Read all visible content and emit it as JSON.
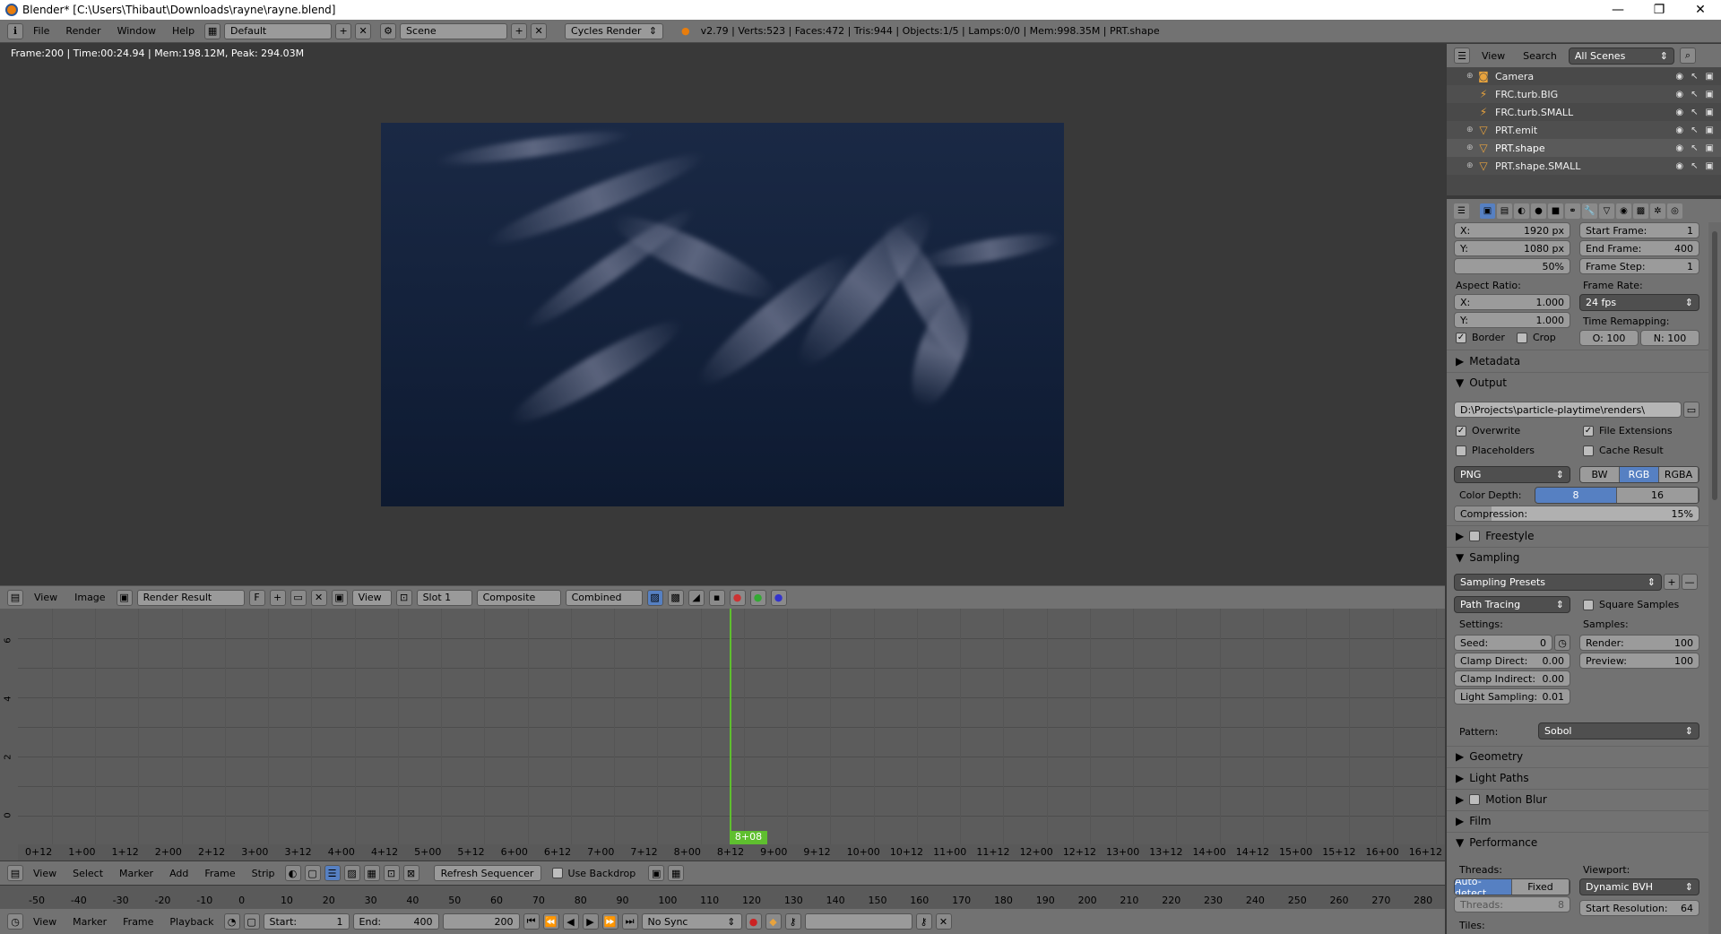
{
  "window": {
    "title": "Blender* [C:\\Users\\Thibaut\\Downloads\\rayne\\rayne.blend]"
  },
  "info_header": {
    "menus": [
      "File",
      "Render",
      "Window",
      "Help"
    ],
    "screen": "Default",
    "scene": "Scene",
    "engine": "Cycles Render",
    "stats": "v2.79 | Verts:523 | Faces:472 | Tris:944 | Objects:1/5 | Lamps:0/0 | Mem:998.35M | PRT.shape"
  },
  "image_editor": {
    "status": "Frame:200 | Time:00:24.94 | Mem:198.12M, Peak: 294.03M",
    "menus": [
      "View",
      "Image"
    ],
    "image_name": "Render Result",
    "fake_user": "F",
    "view_menu": "View",
    "slot": "Slot 1",
    "layer": "Composite",
    "pass": "Combined"
  },
  "graph": {
    "playhead_label": "8+08",
    "y_labels": [
      "6",
      "4",
      "2",
      "0"
    ],
    "x_ticks": [
      "0+12",
      "1+00",
      "1+12",
      "2+00",
      "2+12",
      "3+00",
      "3+12",
      "4+00",
      "4+12",
      "5+00",
      "5+12",
      "6+00",
      "6+12",
      "7+00",
      "7+12",
      "8+00",
      "8+12",
      "9+00",
      "9+12",
      "10+00",
      "10+12",
      "11+00",
      "11+12",
      "12+00",
      "12+12",
      "13+00",
      "13+12",
      "14+00",
      "14+12",
      "15+00",
      "15+12",
      "16+00",
      "16+12"
    ]
  },
  "sequencer_header": {
    "menus": [
      "View",
      "Select",
      "Marker",
      "Add",
      "Frame",
      "Strip"
    ],
    "refresh": "Refresh Sequencer",
    "use_backdrop": "Use Backdrop"
  },
  "timeline": {
    "ticks": [
      "-50",
      "-40",
      "-30",
      "-20",
      "-10",
      "0",
      "10",
      "20",
      "30",
      "40",
      "50",
      "60",
      "70",
      "80",
      "90",
      "100",
      "110",
      "120",
      "130",
      "140",
      "150",
      "160",
      "170",
      "180",
      "190",
      "200",
      "210",
      "220",
      "230",
      "240",
      "250",
      "260",
      "270",
      "280"
    ]
  },
  "timeline_header": {
    "menus": [
      "View",
      "Marker",
      "Frame",
      "Playback"
    ],
    "start_label": "Start:",
    "start": "1",
    "end_label": "End:",
    "end": "400",
    "current": "200",
    "sync": "No Sync"
  },
  "outliner": {
    "menus": [
      "View",
      "Search"
    ],
    "filter": "All Scenes",
    "items": [
      {
        "name": "Camera",
        "icon": "camera-icon"
      },
      {
        "name": "FRC.turb.BIG",
        "icon": "force-field-icon"
      },
      {
        "name": "FRC.turb.SMALL",
        "icon": "force-field-icon"
      },
      {
        "name": "PRT.emit",
        "icon": "mesh-icon"
      },
      {
        "name": "PRT.shape",
        "icon": "mesh-icon"
      },
      {
        "name": "PRT.shape.SMALL",
        "icon": "mesh-icon"
      }
    ]
  },
  "properties": {
    "resolution_x": {
      "label": "X:",
      "value": "1920 px"
    },
    "resolution_y": {
      "label": "Y:",
      "value": "1080 px"
    },
    "resolution_pct": "50%",
    "start_frame": {
      "label": "Start Frame:",
      "value": "1"
    },
    "end_frame": {
      "label": "End Frame:",
      "value": "400"
    },
    "frame_step": {
      "label": "Frame Step:",
      "value": "1"
    },
    "aspect_label": "Aspect Ratio:",
    "aspect_x": {
      "label": "X:",
      "value": "1.000"
    },
    "aspect_y": {
      "label": "Y:",
      "value": "1.000"
    },
    "frame_rate_label": "Frame Rate:",
    "frame_rate": "24 fps",
    "time_remap_label": "Time Remapping:",
    "remap_old": "O: 100",
    "remap_new": "N: 100",
    "border": "Border",
    "crop": "Crop",
    "metadata": "Metadata",
    "output": "Output",
    "output_path": "D:\\Projects\\particle-playtime\\renders\\",
    "overwrite": "Overwrite",
    "file_extensions": "File Extensions",
    "placeholders": "Placeholders",
    "cache_result": "Cache Result",
    "format": "PNG",
    "color_modes": [
      "BW",
      "RGB",
      "RGBA"
    ],
    "color_depth_label": "Color Depth:",
    "color_depths": [
      "8",
      "16"
    ],
    "compression": {
      "label": "Compression:",
      "value": "15%",
      "fraction": 0.15
    },
    "freestyle": "Freestyle",
    "sampling": "Sampling",
    "sampling_presets": "Sampling Presets",
    "integrator": "Path Tracing",
    "square_samples": "Square Samples",
    "settings_label": "Settings:",
    "samples_label": "Samples:",
    "seed": {
      "label": "Seed:",
      "value": "0"
    },
    "clamp_direct": {
      "label": "Clamp Direct:",
      "value": "0.00"
    },
    "clamp_indirect": {
      "label": "Clamp Indirect:",
      "value": "0.00"
    },
    "light_sampling": {
      "label": "Light Sampling:",
      "value": "0.01"
    },
    "render_samples": {
      "label": "Render:",
      "value": "100"
    },
    "preview_samples": {
      "label": "Preview:",
      "value": "100"
    },
    "pattern_label": "Pattern:",
    "pattern": "Sobol",
    "geometry": "Geometry",
    "light_paths": "Light Paths",
    "motion_blur": "Motion Blur",
    "film": "Film",
    "performance": "Performance",
    "threads_label": "Threads:",
    "threads_modes": [
      "Auto-detect",
      "Fixed"
    ],
    "threads": {
      "label": "Threads:",
      "value": "8"
    },
    "viewport_label": "Viewport:",
    "viewport": "Dynamic BVH",
    "start_resolution": {
      "label": "Start Resolution:",
      "value": "64"
    },
    "tiles_label": "Tiles:"
  },
  "colors": {
    "accent": "#5680c2",
    "playhead": "#5fbf2f",
    "panel": "#727272"
  }
}
